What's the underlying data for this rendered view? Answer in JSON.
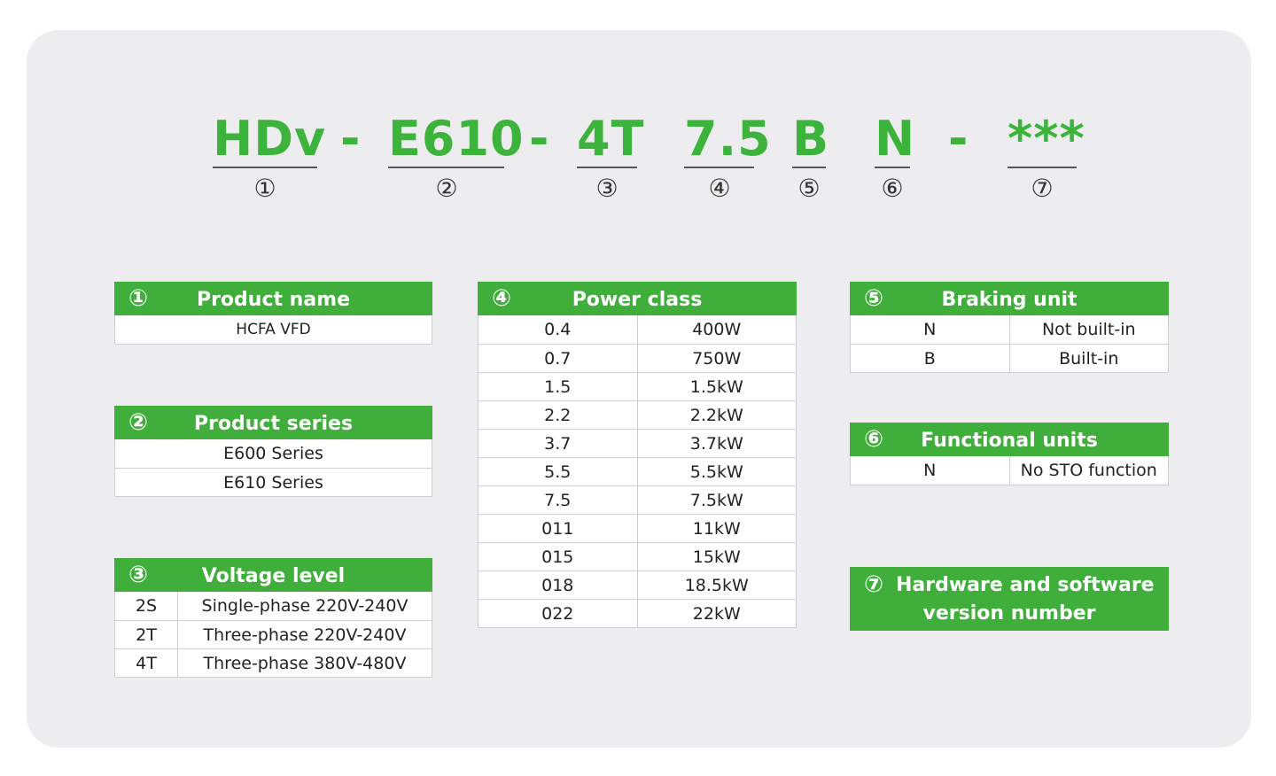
{
  "code": {
    "segments": [
      "HDv",
      "E610",
      "4T",
      "7.5",
      "B",
      "N",
      "***"
    ],
    "separators": [
      "-",
      "-",
      "-"
    ],
    "numbers": [
      "①",
      "②",
      "③",
      "④",
      "⑤",
      "⑥",
      "⑦"
    ]
  },
  "tables": {
    "product_name": {
      "num": "①",
      "title": "Product name",
      "rows": [
        "HCFA VFD"
      ]
    },
    "product_series": {
      "num": "②",
      "title": "Product series",
      "rows": [
        "E600 Series",
        "E610 Series"
      ]
    },
    "voltage_level": {
      "num": "③",
      "title": "Voltage level",
      "rows": [
        {
          "code": "2S",
          "desc": "Single-phase 220V-240V"
        },
        {
          "code": "2T",
          "desc": "Three-phase 220V-240V"
        },
        {
          "code": "4T",
          "desc": "Three-phase 380V-480V"
        }
      ]
    },
    "power_class": {
      "num": "④",
      "title": "Power class",
      "rows": [
        {
          "code": "0.4",
          "desc": "400W"
        },
        {
          "code": "0.7",
          "desc": "750W"
        },
        {
          "code": "1.5",
          "desc": "1.5kW"
        },
        {
          "code": "2.2",
          "desc": "2.2kW"
        },
        {
          "code": "3.7",
          "desc": "3.7kW"
        },
        {
          "code": "5.5",
          "desc": "5.5kW"
        },
        {
          "code": "7.5",
          "desc": "7.5kW"
        },
        {
          "code": "011",
          "desc": "11kW"
        },
        {
          "code": "015",
          "desc": "15kW"
        },
        {
          "code": "018",
          "desc": "18.5kW"
        },
        {
          "code": "022",
          "desc": "22kW"
        }
      ]
    },
    "braking_unit": {
      "num": "⑤",
      "title": "Braking unit",
      "rows": [
        {
          "code": "N",
          "desc": "Not built-in"
        },
        {
          "code": "B",
          "desc": "Built-in"
        }
      ]
    },
    "functional_units": {
      "num": "⑥",
      "title": "Functional units",
      "rows": [
        {
          "code": "N",
          "desc": "No STO function"
        }
      ]
    },
    "hw_sw_version": {
      "num": "⑦",
      "title_line1": "Hardware and software",
      "title_line2": "version number"
    }
  },
  "colors": {
    "accent": "#3fae3a",
    "code_text": "#3cb33a",
    "card_bg": "#ededf0"
  }
}
